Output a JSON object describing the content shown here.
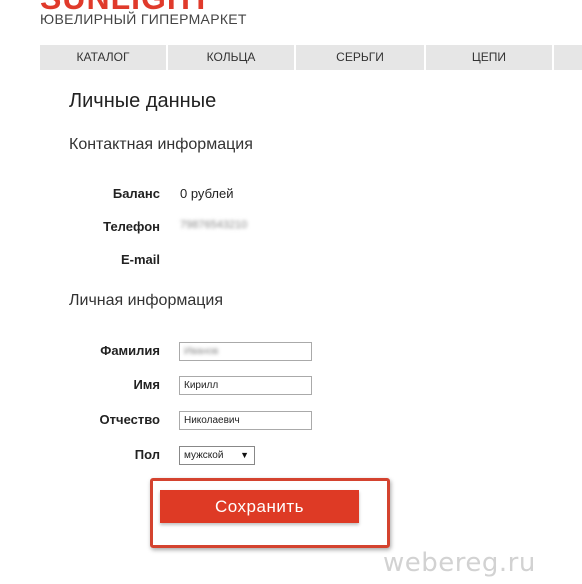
{
  "brand": {
    "logo": "SUNLIGHT",
    "tagline": "ЮВЕЛИРНЫЙ ГИПЕРМАРКЕТ",
    "accent_color": "#e03a2b"
  },
  "nav": {
    "items": [
      "КАТАЛОГ",
      "КОЛЬЦА",
      "СЕРЬГИ",
      "ЦЕПИ",
      ""
    ]
  },
  "page": {
    "title": "Личные данные"
  },
  "contact": {
    "heading": "Контактная информация",
    "balance_label": "Баланс",
    "balance_value": "0 рублей",
    "phone_label": "Телефон",
    "phone_value": "79876543210",
    "email_label": "E-mail",
    "email_value": ""
  },
  "personal": {
    "heading": "Личная информация",
    "surname_label": "Фамилия",
    "surname_value": "Иванов",
    "name_label": "Имя",
    "name_value": "Кирилл",
    "patronymic_label": "Отчество",
    "patronymic_value": "Николаевич",
    "gender_label": "Пол",
    "gender_value": "мужской",
    "gender_arrow_icon": "triangle-down"
  },
  "actions": {
    "save_label": "Сохранить",
    "button_color": "#de3a25"
  },
  "watermark": "webereg.ru"
}
